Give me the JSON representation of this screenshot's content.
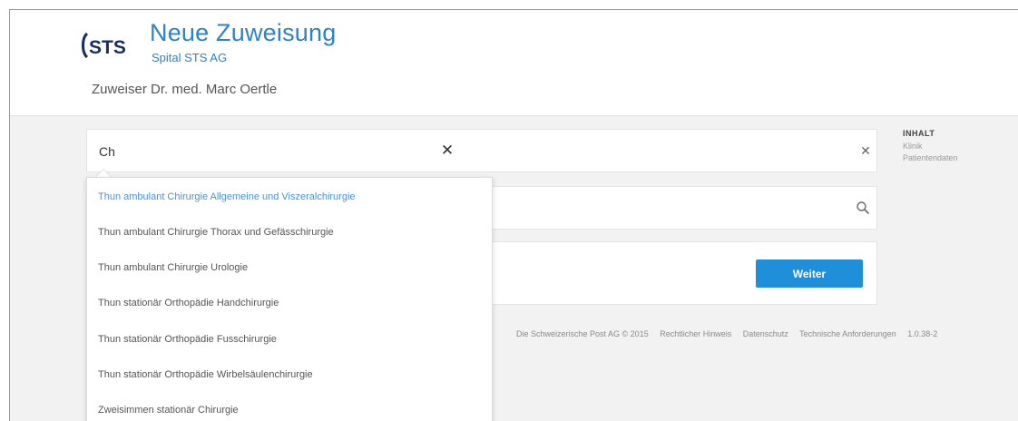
{
  "header": {
    "logo_text": "STS",
    "title": "Neue Zuweisung",
    "subtitle": "Spital STS AG",
    "referrer": "Zuweiser Dr. med. Marc Oertle"
  },
  "search": {
    "value": "Ch"
  },
  "suggestions": [
    "Thun ambulant Chirurgie Allgemeine und Viszeralchirurgie",
    "Thun ambulant Chirurgie Thorax und Gefässchirurgie",
    "Thun ambulant Chirurgie Urologie",
    "Thun stationär Orthopädie Handchirurgie",
    "Thun stationär Orthopädie Fusschirurgie",
    "Thun stationär Orthopädie Wirbelsäulenchirurgie",
    "Zweisimmen stationär Chirurgie"
  ],
  "actions": {
    "next_label": "Weiter"
  },
  "toc": {
    "title": "INHALT",
    "items": [
      "Klinik",
      "Patientendaten"
    ]
  },
  "footer": {
    "copyright": "Die Schweizerische Post AG © 2015",
    "legal": "Rechtlicher Hinweis",
    "privacy": "Datenschutz",
    "tech": "Technische Anforderungen",
    "version": "1.0.38-2"
  },
  "colors": {
    "brand_blue": "#2e82c8",
    "button_blue": "#1e8fd8",
    "active_item": "#4a90d9",
    "background": "#f2f2f2"
  },
  "icons": [
    "sts-logo",
    "close-icon",
    "search-icon"
  ]
}
